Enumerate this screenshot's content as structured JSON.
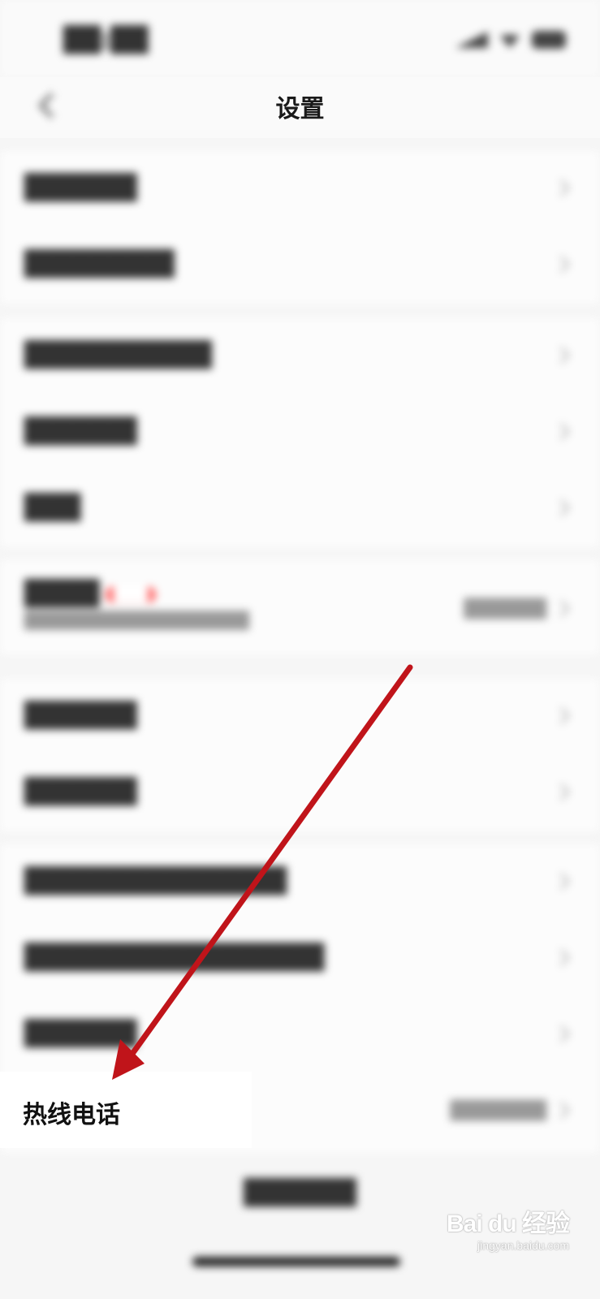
{
  "header": {
    "title": "设置"
  },
  "hotline": {
    "label": "热线电话"
  },
  "watermark": {
    "brand": "Bai du 经验",
    "url": "jingyan.baidu.com"
  },
  "annotation": {
    "color": "#c0141a"
  }
}
